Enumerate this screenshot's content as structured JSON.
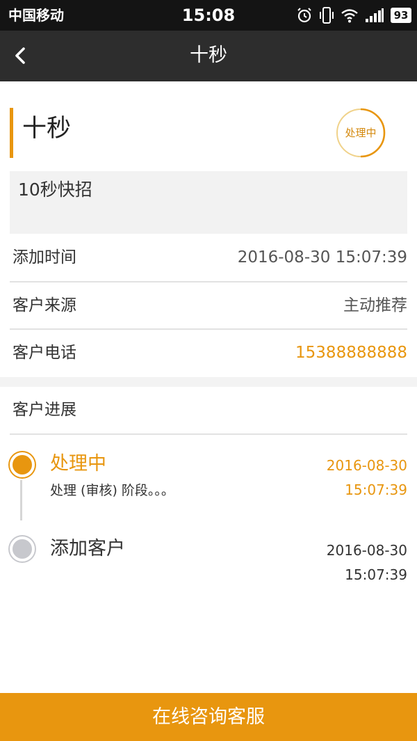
{
  "status_bar": {
    "carrier": "中国移动",
    "time": "15:08",
    "battery": "93",
    "icons": [
      "alarm-icon",
      "vibrate-icon",
      "wifi-icon",
      "signal-icon",
      "battery-icon"
    ]
  },
  "nav": {
    "back_icon": "chevron-left-icon",
    "title": "十秒"
  },
  "record": {
    "title": "十秒",
    "status_badge": "处理中",
    "description": "10秒快招"
  },
  "info": {
    "add_time_label": "添加时间",
    "add_time_value": "2016-08-30 15:07:39",
    "source_label": "客户来源",
    "source_value": "主动推荐",
    "phone_label": "客户电话",
    "phone_value": "15388888888"
  },
  "progress": {
    "heading": "客户进展",
    "items": [
      {
        "title": "处理中",
        "note": "处理 (审核) 阶段。。。",
        "date": "2016-08-30",
        "time": "15:07:39"
      },
      {
        "title": "添加客户",
        "date": "2016-08-30",
        "time": "15:07:39"
      }
    ]
  },
  "footer": {
    "consult_label": "在线咨询客服"
  },
  "colors": {
    "accent": "#e8960f",
    "nav_bg": "#2d2d2d",
    "status_bg": "#141414",
    "inactive_dot": "#c7c8cd"
  }
}
